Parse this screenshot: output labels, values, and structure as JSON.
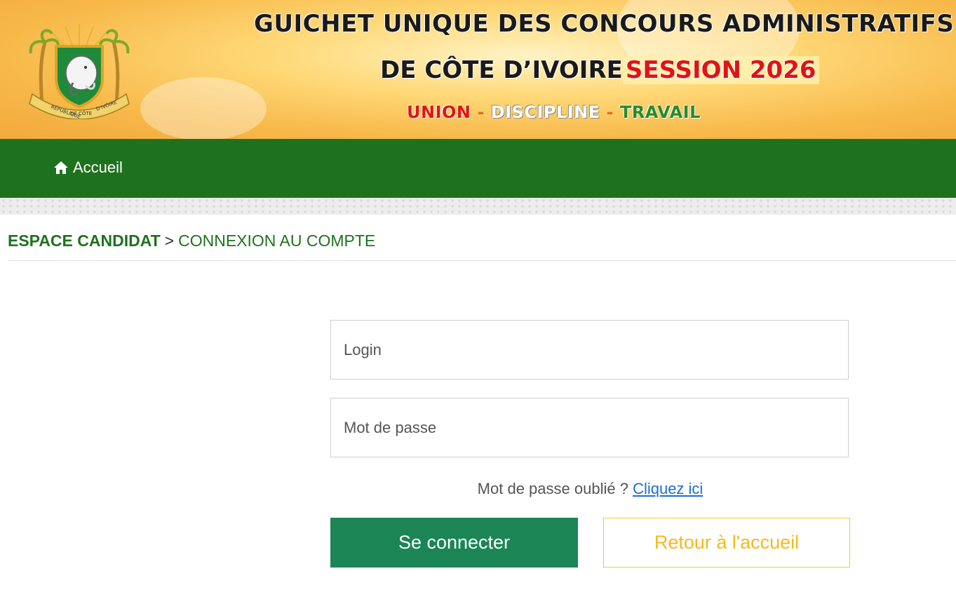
{
  "banner": {
    "title_line1": "GUICHET UNIQUE DES CONCOURS ADMINISTRATIFS",
    "title_line2": "DE CÔTE D’IVOIRE",
    "session": "SESSION 2026",
    "motto": {
      "union": "UNION",
      "discipline": "DISCIPLINE",
      "travail": "TRAVAIL",
      "separator": "-"
    },
    "emblem_icon": "coat-of-arms-icon",
    "emblem_text_top": "RÉPUBLIQUE",
    "emblem_text_mid": "DE CÔTE",
    "emblem_text_right": "D'IVOIRE"
  },
  "nav": {
    "home_label": "Accueil",
    "home_icon": "home-icon"
  },
  "breadcrumb": {
    "root": "ESPACE CANDIDAT",
    "separator": ">",
    "current": "CONNEXION AU COMPTE"
  },
  "form": {
    "login_placeholder": "Login",
    "password_placeholder": "Mot de passe",
    "forgot_text": "Mot de passe oublié ?",
    "forgot_link": "Cliquez ici",
    "submit_label": "Se connecter",
    "back_label": "Retour à l'accueil"
  },
  "colors": {
    "nav_green": "#1e721e",
    "submit_green": "#1b8555",
    "back_yellow": "#f4b91e",
    "session_red": "#e01414"
  }
}
